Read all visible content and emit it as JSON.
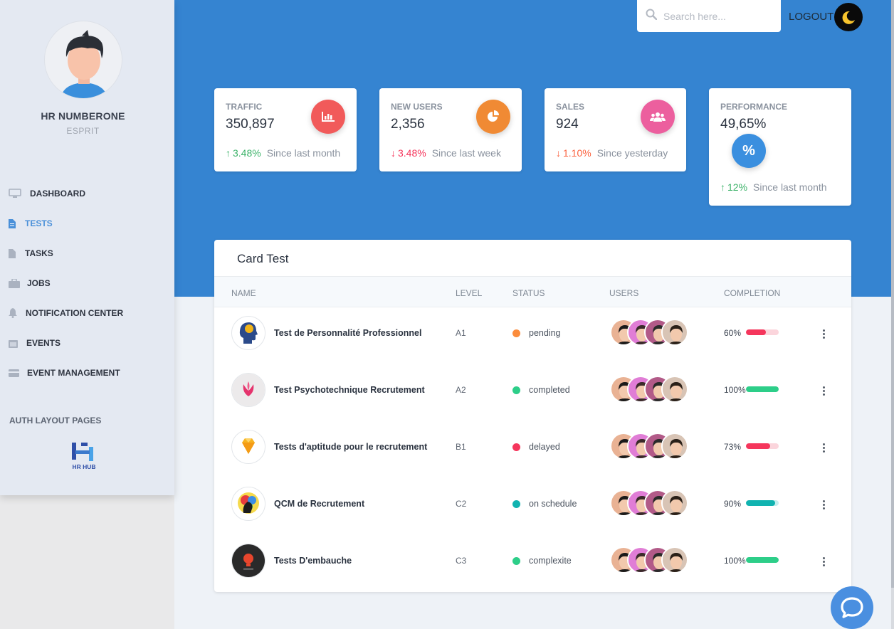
{
  "profile": {
    "name": "HR NUMBERONE",
    "org": "ESPRIT"
  },
  "sidebar": {
    "items": [
      {
        "label": "DASHBOARD",
        "icon": "monitor-icon",
        "active": false
      },
      {
        "label": "TESTS",
        "icon": "file-icon",
        "active": true
      },
      {
        "label": "TASKS",
        "icon": "file-icon",
        "active": false
      },
      {
        "label": "JOBS",
        "icon": "briefcase-icon",
        "active": false
      },
      {
        "label": "NOTIFICATION CENTER",
        "icon": "bell-icon",
        "active": false
      },
      {
        "label": "EVENTS",
        "icon": "calendar-icon",
        "active": false
      },
      {
        "label": "EVENT MANAGEMENT",
        "icon": "credit-card-icon",
        "active": false
      }
    ],
    "section_heading": "AUTH LAYOUT PAGES",
    "logo_text": "HR HUB"
  },
  "topbar": {
    "search_placeholder": "Search here...",
    "logout_label": "LOGOUT"
  },
  "stats": [
    {
      "title": "TRAFFIC",
      "value": "350,897",
      "change": "3.48%",
      "direction": "up",
      "since": "Since last month",
      "icon": "chart-bar-icon",
      "color": "#f5365c"
    },
    {
      "title": "NEW USERS",
      "value": "2,356",
      "change": "3.48%",
      "direction": "down",
      "since": "Since last week",
      "icon": "chart-pie-icon",
      "color": "#fb6340"
    },
    {
      "title": "SALES",
      "value": "924",
      "change": "1.10%",
      "direction": "down",
      "since": "Since yesterday",
      "icon": "users-icon",
      "color": "#f3579b"
    },
    {
      "title": "PERFORMANCE",
      "value": "49,65%",
      "change": "12%",
      "direction": "up",
      "since": "Since last month",
      "icon": "percent-icon",
      "color": "#3d8fe0"
    }
  ],
  "table": {
    "title": "Card Test",
    "columns": [
      "NAME",
      "LEVEL",
      "STATUS",
      "USERS",
      "COMPLETION"
    ],
    "rows": [
      {
        "name": "Test de Personnalité Professionnel",
        "level": "A1",
        "status": "pending",
        "status_color": "#fb8c3c",
        "completion": "60%",
        "completion_value": 0.6,
        "bar_color": "#f5365c",
        "bar_bg": "#fbd5dc",
        "thumb": "head-icon"
      },
      {
        "name": "Test Psychotechnique Recrutement",
        "level": "A2",
        "status": "completed",
        "status_color": "#2dce89",
        "completion": "100%",
        "completion_value": 1.0,
        "bar_color": "#2dce89",
        "bar_bg": "#c9f1de",
        "thumb": "lotus-icon"
      },
      {
        "name": "Tests d'aptitude pour le recrutement",
        "level": "B1",
        "status": "delayed",
        "status_color": "#f5365c",
        "completion": "73%",
        "completion_value": 0.73,
        "bar_color": "#f5365c",
        "bar_bg": "#fbd5dc",
        "thumb": "diamond-icon"
      },
      {
        "name": "QCM de Recrutement",
        "level": "C2",
        "status": "on schedule",
        "status_color": "#11b3b0",
        "completion": "90%",
        "completion_value": 0.9,
        "bar_color": "#11b3b0",
        "bar_bg": "#c5eeee",
        "thumb": "colorful-head-icon"
      },
      {
        "name": "Tests D'embauche",
        "level": "C3",
        "status": "complexite",
        "status_color": "#2dce89",
        "completion": "100%",
        "completion_value": 1.0,
        "bar_color": "#2dce89",
        "bar_bg": "#c9f1de",
        "thumb": "bulb-icon"
      }
    ]
  }
}
